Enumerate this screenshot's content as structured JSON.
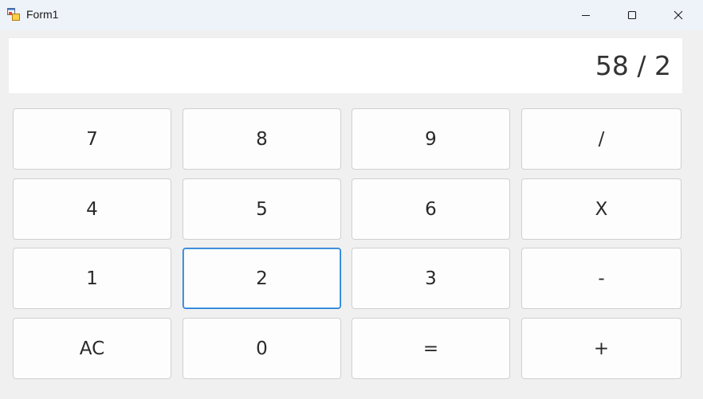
{
  "window": {
    "title": "Form1",
    "app_icon": "form-app-icon",
    "controls": {
      "minimize_icon": "minimize-icon",
      "maximize_icon": "maximize-icon",
      "close_icon": "close-icon"
    }
  },
  "display": {
    "value": "58 / 2"
  },
  "keypad": {
    "row1": [
      "7",
      "8",
      "9",
      "/"
    ],
    "row2": [
      "4",
      "5",
      "6",
      "X"
    ],
    "row3": [
      "1",
      "2",
      "3",
      "-"
    ],
    "row4": [
      "AC",
      "0",
      "=",
      "+"
    ]
  },
  "colors": {
    "titlebar_bg": "#eef2f9",
    "window_bg": "#f0f0f0",
    "focus_border": "#1f7ad4"
  }
}
